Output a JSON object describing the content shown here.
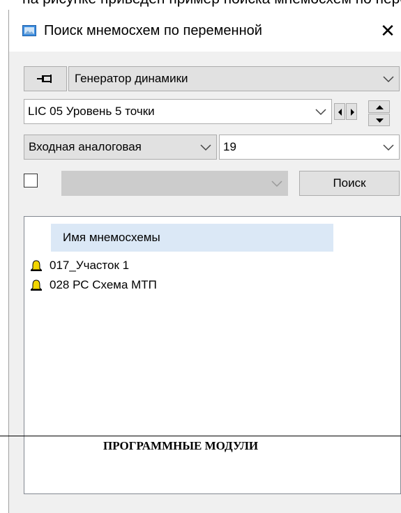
{
  "background_text": "на рисунке приведен пример поиска мнемосхем по переменной динамики",
  "window": {
    "title": "Поиск мнемосхем по переменной",
    "close_glyph": "✕"
  },
  "controls": {
    "source_select": "Генератор динамики",
    "variable_select": "LIC 05 Уровень  5 точки",
    "type_select": "Входная аналоговая",
    "index_select": "19",
    "filter_select": "",
    "search_button": "Поиск"
  },
  "results": {
    "column_header": "Имя мнемосхемы",
    "items": [
      {
        "name": "017_Участок 1",
        "icon": "bell-icon"
      },
      {
        "name": "028 РС Схема МТП",
        "icon": "bell-icon"
      }
    ]
  },
  "document_heading": "ПРОГРАММНЫЕ МОДУЛИ",
  "colors": {
    "header_highlight": "#dbe8f6",
    "bell": "#f2d600",
    "window_bg": "#f0f0f0"
  }
}
